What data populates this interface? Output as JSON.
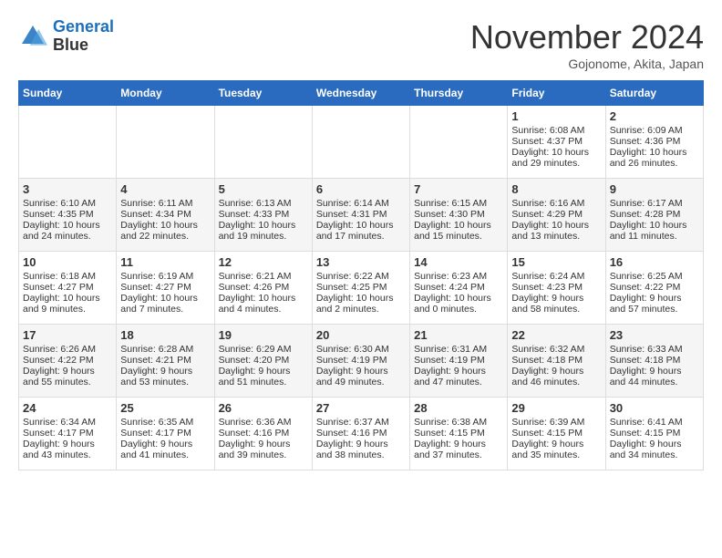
{
  "header": {
    "logo_line1": "General",
    "logo_line2": "Blue",
    "month": "November 2024",
    "location": "Gojonome, Akita, Japan"
  },
  "weekdays": [
    "Sunday",
    "Monday",
    "Tuesday",
    "Wednesday",
    "Thursday",
    "Friday",
    "Saturday"
  ],
  "weeks": [
    [
      {
        "day": "",
        "content": ""
      },
      {
        "day": "",
        "content": ""
      },
      {
        "day": "",
        "content": ""
      },
      {
        "day": "",
        "content": ""
      },
      {
        "day": "",
        "content": ""
      },
      {
        "day": "1",
        "content": "Sunrise: 6:08 AM\nSunset: 4:37 PM\nDaylight: 10 hours and 29 minutes."
      },
      {
        "day": "2",
        "content": "Sunrise: 6:09 AM\nSunset: 4:36 PM\nDaylight: 10 hours and 26 minutes."
      }
    ],
    [
      {
        "day": "3",
        "content": "Sunrise: 6:10 AM\nSunset: 4:35 PM\nDaylight: 10 hours and 24 minutes."
      },
      {
        "day": "4",
        "content": "Sunrise: 6:11 AM\nSunset: 4:34 PM\nDaylight: 10 hours and 22 minutes."
      },
      {
        "day": "5",
        "content": "Sunrise: 6:13 AM\nSunset: 4:33 PM\nDaylight: 10 hours and 19 minutes."
      },
      {
        "day": "6",
        "content": "Sunrise: 6:14 AM\nSunset: 4:31 PM\nDaylight: 10 hours and 17 minutes."
      },
      {
        "day": "7",
        "content": "Sunrise: 6:15 AM\nSunset: 4:30 PM\nDaylight: 10 hours and 15 minutes."
      },
      {
        "day": "8",
        "content": "Sunrise: 6:16 AM\nSunset: 4:29 PM\nDaylight: 10 hours and 13 minutes."
      },
      {
        "day": "9",
        "content": "Sunrise: 6:17 AM\nSunset: 4:28 PM\nDaylight: 10 hours and 11 minutes."
      }
    ],
    [
      {
        "day": "10",
        "content": "Sunrise: 6:18 AM\nSunset: 4:27 PM\nDaylight: 10 hours and 9 minutes."
      },
      {
        "day": "11",
        "content": "Sunrise: 6:19 AM\nSunset: 4:27 PM\nDaylight: 10 hours and 7 minutes."
      },
      {
        "day": "12",
        "content": "Sunrise: 6:21 AM\nSunset: 4:26 PM\nDaylight: 10 hours and 4 minutes."
      },
      {
        "day": "13",
        "content": "Sunrise: 6:22 AM\nSunset: 4:25 PM\nDaylight: 10 hours and 2 minutes."
      },
      {
        "day": "14",
        "content": "Sunrise: 6:23 AM\nSunset: 4:24 PM\nDaylight: 10 hours and 0 minutes."
      },
      {
        "day": "15",
        "content": "Sunrise: 6:24 AM\nSunset: 4:23 PM\nDaylight: 9 hours and 58 minutes."
      },
      {
        "day": "16",
        "content": "Sunrise: 6:25 AM\nSunset: 4:22 PM\nDaylight: 9 hours and 57 minutes."
      }
    ],
    [
      {
        "day": "17",
        "content": "Sunrise: 6:26 AM\nSunset: 4:22 PM\nDaylight: 9 hours and 55 minutes."
      },
      {
        "day": "18",
        "content": "Sunrise: 6:28 AM\nSunset: 4:21 PM\nDaylight: 9 hours and 53 minutes."
      },
      {
        "day": "19",
        "content": "Sunrise: 6:29 AM\nSunset: 4:20 PM\nDaylight: 9 hours and 51 minutes."
      },
      {
        "day": "20",
        "content": "Sunrise: 6:30 AM\nSunset: 4:19 PM\nDaylight: 9 hours and 49 minutes."
      },
      {
        "day": "21",
        "content": "Sunrise: 6:31 AM\nSunset: 4:19 PM\nDaylight: 9 hours and 47 minutes."
      },
      {
        "day": "22",
        "content": "Sunrise: 6:32 AM\nSunset: 4:18 PM\nDaylight: 9 hours and 46 minutes."
      },
      {
        "day": "23",
        "content": "Sunrise: 6:33 AM\nSunset: 4:18 PM\nDaylight: 9 hours and 44 minutes."
      }
    ],
    [
      {
        "day": "24",
        "content": "Sunrise: 6:34 AM\nSunset: 4:17 PM\nDaylight: 9 hours and 43 minutes."
      },
      {
        "day": "25",
        "content": "Sunrise: 6:35 AM\nSunset: 4:17 PM\nDaylight: 9 hours and 41 minutes."
      },
      {
        "day": "26",
        "content": "Sunrise: 6:36 AM\nSunset: 4:16 PM\nDaylight: 9 hours and 39 minutes."
      },
      {
        "day": "27",
        "content": "Sunrise: 6:37 AM\nSunset: 4:16 PM\nDaylight: 9 hours and 38 minutes."
      },
      {
        "day": "28",
        "content": "Sunrise: 6:38 AM\nSunset: 4:15 PM\nDaylight: 9 hours and 37 minutes."
      },
      {
        "day": "29",
        "content": "Sunrise: 6:39 AM\nSunset: 4:15 PM\nDaylight: 9 hours and 35 minutes."
      },
      {
        "day": "30",
        "content": "Sunrise: 6:41 AM\nSunset: 4:15 PM\nDaylight: 9 hours and 34 minutes."
      }
    ]
  ]
}
